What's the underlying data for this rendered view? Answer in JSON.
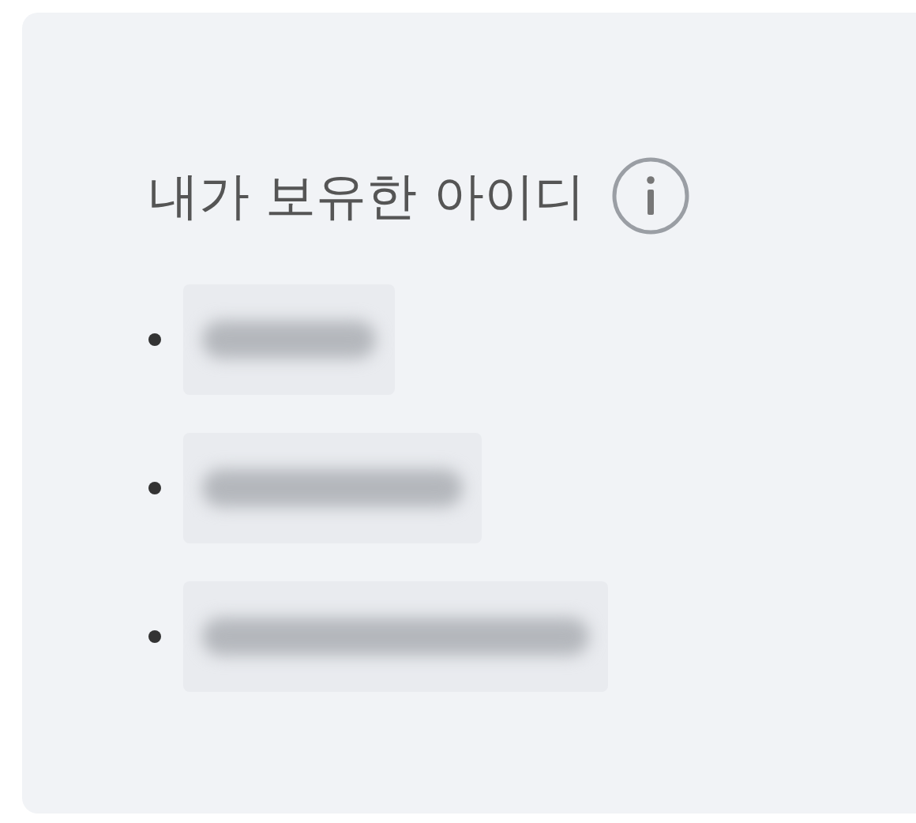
{
  "card": {
    "title": "내가 보유한 아이디",
    "items": [
      {
        "kind": "redacted"
      },
      {
        "kind": "redacted"
      },
      {
        "kind": "redacted"
      }
    ]
  }
}
